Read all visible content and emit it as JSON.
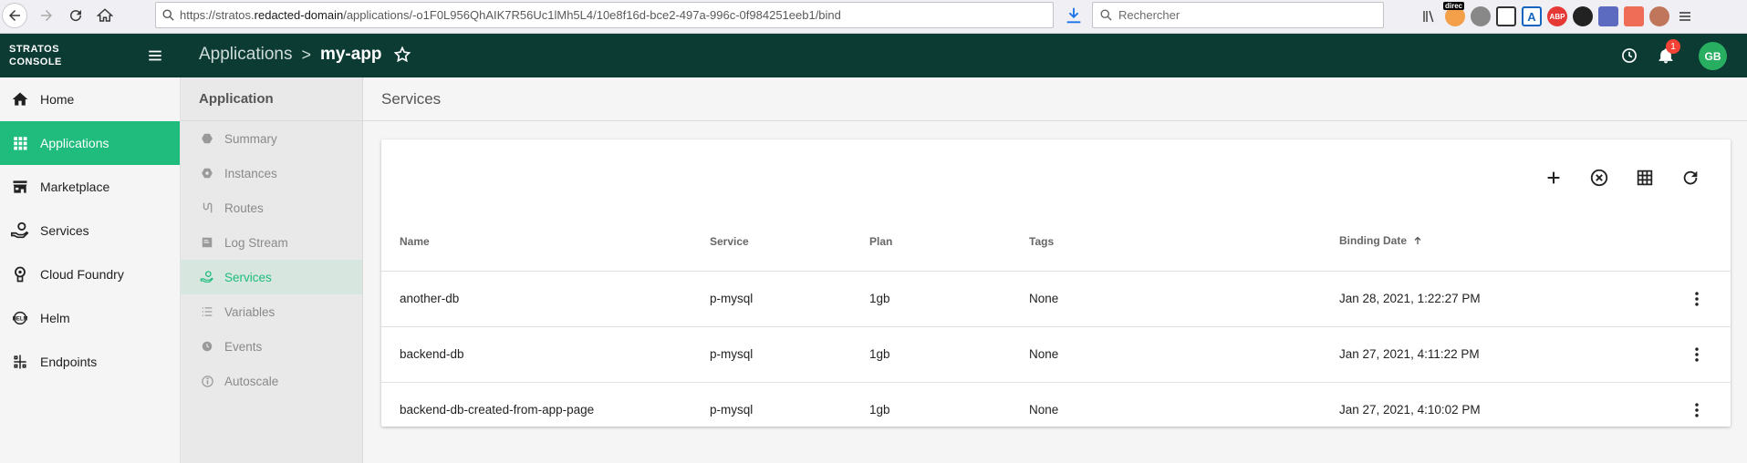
{
  "browser": {
    "url_prefix": "https://stratos.",
    "url_domain": "redacted-domain",
    "url_path": "/applications/-o1F0L956QhAIK7R56Uc1lMh5L4/10e8f16d-bce2-497a-996c-0f984251eeb1/bind",
    "search_placeholder": "Rechercher",
    "extensions": [
      "library-icon",
      "direct-ext-icon",
      "settings-ext-icon",
      "reader-icon",
      "translate-icon",
      "adblock-icon",
      "privacy-icon",
      "screenshot-icon",
      "tree-icon",
      "firefox-account-icon",
      "menu-icon"
    ],
    "ext_labels": {
      "adblock": "ABP",
      "translate": "A",
      "direct": "direc"
    }
  },
  "header": {
    "logo_line1": "STRATOS",
    "logo_line2": "CONSOLE",
    "crumb_parent": "Applications",
    "crumb_sep": ">",
    "crumb_current": "my-app",
    "notification_count": "1",
    "avatar_initials": "GB",
    "bg_color": "#0c3b34"
  },
  "nav": {
    "items": [
      {
        "label": "Home",
        "icon": "home-icon"
      },
      {
        "label": "Applications",
        "icon": "apps-grid-icon",
        "active": true
      },
      {
        "label": "Marketplace",
        "icon": "store-icon"
      },
      {
        "label": "Services",
        "icon": "service-hand-icon"
      },
      {
        "label": "Cloud Foundry",
        "icon": "cloud-foundry-icon"
      },
      {
        "label": "Helm",
        "icon": "helm-icon"
      },
      {
        "label": "Endpoints",
        "icon": "endpoints-icon"
      }
    ],
    "active_color": "#1fbc7d"
  },
  "subnav": {
    "title": "Application",
    "items": [
      {
        "label": "Summary",
        "icon": "summary-icon"
      },
      {
        "label": "Instances",
        "icon": "instances-icon"
      },
      {
        "label": "Routes",
        "icon": "routes-icon"
      },
      {
        "label": "Log Stream",
        "icon": "log-stream-icon"
      },
      {
        "label": "Services",
        "icon": "services-icon",
        "active": true
      },
      {
        "label": "Variables",
        "icon": "variables-icon"
      },
      {
        "label": "Events",
        "icon": "events-icon"
      },
      {
        "label": "Autoscale",
        "icon": "autoscale-icon"
      }
    ]
  },
  "main": {
    "title": "Services",
    "toolbar": [
      "add-icon",
      "cancel-circle-icon",
      "grid-view-icon",
      "refresh-icon"
    ],
    "columns": [
      "Name",
      "Service",
      "Plan",
      "Tags",
      "Binding Date"
    ],
    "sorted_column": "Binding Date",
    "rows": [
      {
        "name": "another-db",
        "service": "p-mysql",
        "plan": "1gb",
        "tags": "None",
        "date": "Jan 28, 2021, 1:22:27 PM"
      },
      {
        "name": "backend-db",
        "service": "p-mysql",
        "plan": "1gb",
        "tags": "None",
        "date": "Jan 27, 2021, 4:11:22 PM"
      },
      {
        "name": "backend-db-created-from-app-page",
        "service": "p-mysql",
        "plan": "1gb",
        "tags": "None",
        "date": "Jan 27, 2021, 4:10:02 PM"
      }
    ]
  }
}
